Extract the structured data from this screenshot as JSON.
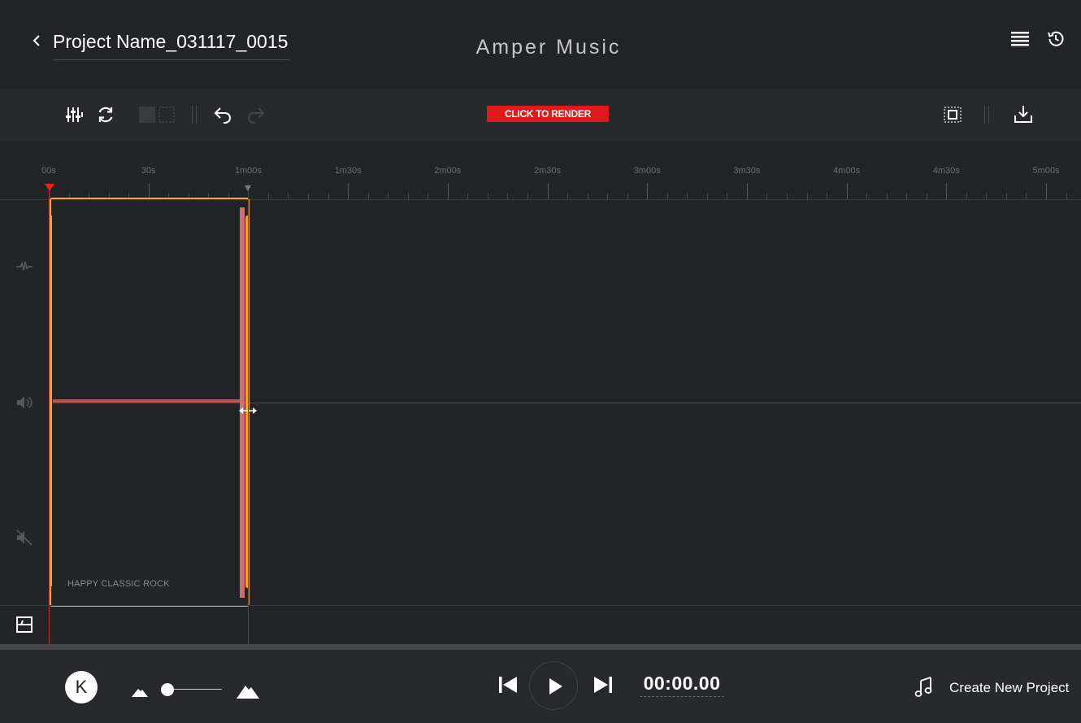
{
  "header": {
    "project_name": "Project Name_031117_0015",
    "brand": "Amper Music"
  },
  "toolbar": {
    "render_label": "CLICK TO RENDER"
  },
  "timeline": {
    "ticks": [
      "00s",
      "30s",
      "1m00s",
      "1m30s",
      "2m00s",
      "2m30s",
      "3m00s",
      "3m30s",
      "4m00s",
      "4m30s",
      "5m00s"
    ],
    "region_label": "HAPPY CLASSIC ROCK"
  },
  "footer": {
    "avatar_initial": "K",
    "timecode": "00:00.00",
    "new_project_label": "Create New Project"
  },
  "colors": {
    "background": "#232427",
    "accent_region": "#f0a531",
    "render": "#e01a1a",
    "playhead": "#e12520"
  }
}
